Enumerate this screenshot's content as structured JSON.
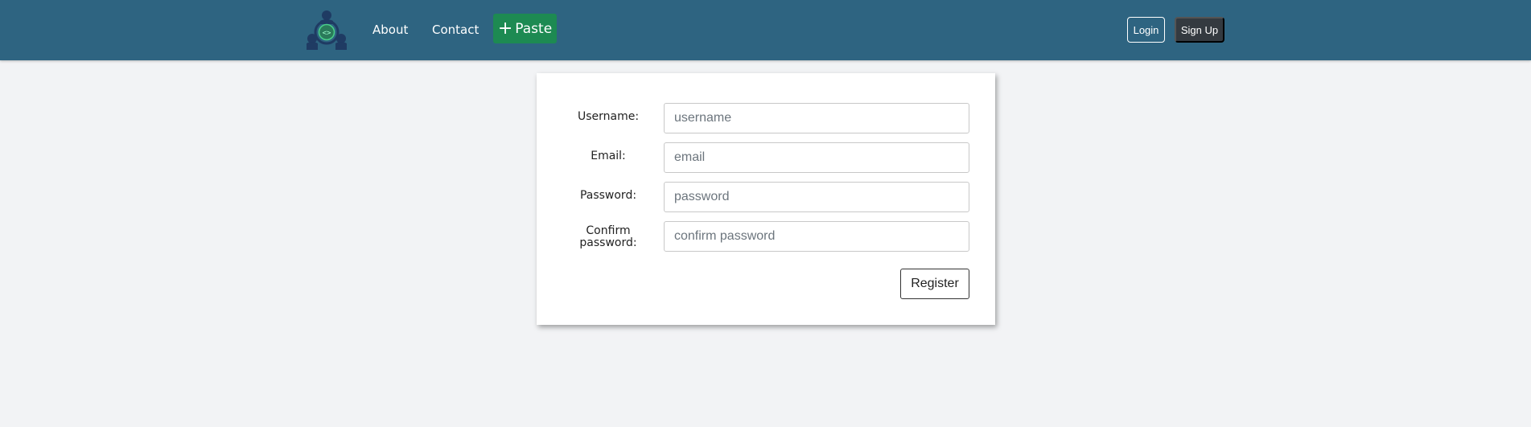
{
  "navbar": {
    "logo_alt": "",
    "links": [
      {
        "label": "About"
      },
      {
        "label": "Contact"
      }
    ],
    "paste_button": {
      "icon": "plus-icon",
      "label": "Paste"
    },
    "login_label": "Login",
    "signup_label": "Sign Up",
    "colors": {
      "background": "#2e6481",
      "paste": "#1d8a52",
      "signup": "#343a40"
    }
  },
  "form": {
    "fields": [
      {
        "label": "Username:",
        "placeholder": "username",
        "value": ""
      },
      {
        "label": "Email:",
        "placeholder": "email",
        "value": ""
      },
      {
        "label": "Password:",
        "placeholder": "password",
        "value": ""
      },
      {
        "label_line1": "Confirm",
        "label_line2": "password:",
        "placeholder": "confirm password",
        "value": ""
      }
    ],
    "submit_label": "Register"
  }
}
